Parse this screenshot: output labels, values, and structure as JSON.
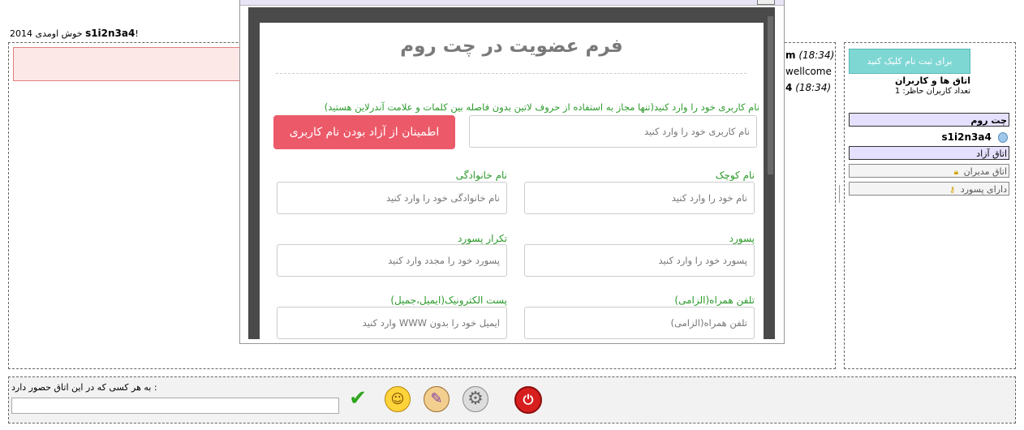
{
  "greeting": {
    "prefix": "2014",
    "middle": "خوش اومدی",
    "username": "s1i2n3a4",
    "suffix": "!"
  },
  "chat": {
    "messages": [
      {
        "time": "(18:34)",
        "sender": "m",
        "text": ""
      },
      {
        "time": "",
        "sender": "",
        "text": "wellcome"
      },
      {
        "time": "(18:34)",
        "sender": "4",
        "text": ""
      }
    ]
  },
  "sidebar": {
    "register_button": "برای ثبت نام کلیک کنید",
    "rooms_title": "اتاق ها و کاربران",
    "online_count": "تعداد کاربران حاظر: 1",
    "chatroom_header": "چت روم",
    "current_user": "s1i2n3a4",
    "rooms": [
      {
        "name": "اتاق آزاد"
      },
      {
        "name": "اتاق مدیران",
        "icon": "lock-icon"
      },
      {
        "name": "دارای پسورد",
        "icon": "key-icon"
      }
    ]
  },
  "bottom": {
    "to_all_label": "به هر کسی که در این اتاق حصور دارد :",
    "message_value": "",
    "icons": [
      "check-icon",
      "smiley-icon",
      "palette-icon",
      "gear-icon",
      "power-icon"
    ]
  },
  "form": {
    "title": "فرم عضویت در چت روم",
    "username_hint": "نام کاربری خود را وارد کنید(تنها مجاز به استفاده از حروف لاتین بدون فاصله بین کلمات و علامت آندرلاین هستید)",
    "username_placeholder": "نام کاربری خود را وارد کنید",
    "check_button": "اطمینان از آزاد بودن نام کاربری",
    "firstname_label": "نام کوچک",
    "firstname_placeholder": "نام خود را وارد کنید",
    "lastname_label": "نام خانوادگی",
    "lastname_placeholder": "نام خانوادگی خود را وارد کنید",
    "password_label": "پسورد",
    "password_placeholder": "پسورد خود را وارد کنید",
    "password_repeat_label": "تکرار پسورد",
    "password_repeat_placeholder": "پسورد خود را مجدد وارد کنید",
    "mobile_label": "تلفن همراه(الزامی)",
    "mobile_placeholder": "تلفن همراه(الزامی)",
    "email_label": "پست الکترونیک(ایمیل،جمیل)",
    "email_placeholder": "ایمیل خود را بدون WWW وارد کنید"
  },
  "colors": {
    "accent_teal": "#7fd7d4",
    "danger_red": "#ec5a6a",
    "label_green": "#2a9a2a",
    "room_highlight": "#e6e0ff"
  }
}
